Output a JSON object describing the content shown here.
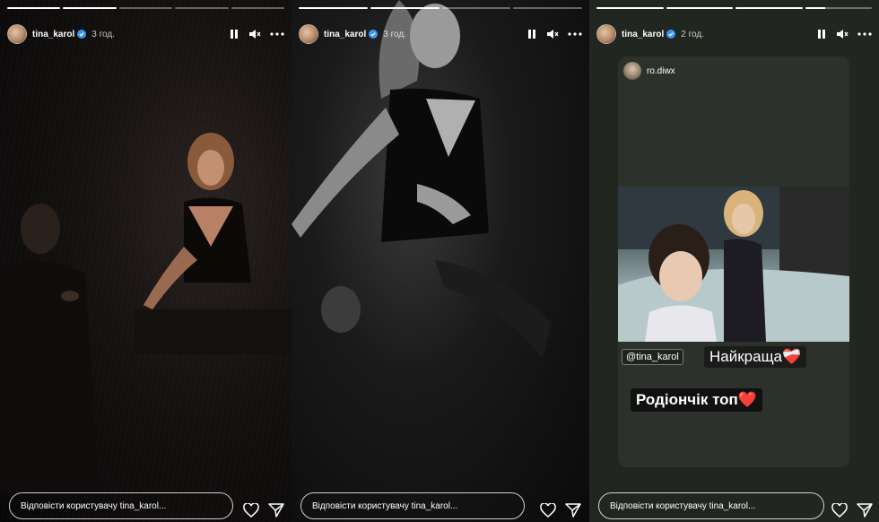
{
  "stories": [
    {
      "username": "tina_karol",
      "timestamp": "3 год.",
      "reply_placeholder": "Відповісти користувачу tina_karol...",
      "progress": [
        1,
        1,
        0,
        0,
        0
      ]
    },
    {
      "username": "tina_karol",
      "timestamp": "3 год.",
      "reply_placeholder": "Відповісти користувачу tina_karol...",
      "progress": [
        1,
        1,
        0,
        0
      ]
    },
    {
      "username": "tina_karol",
      "timestamp": "2 год.",
      "reply_placeholder": "Відповісти користувачу tina_karol...",
      "progress": [
        1,
        1,
        1,
        0.3
      ],
      "repost": {
        "username": "ro.diwx",
        "mention": "@tina_karol",
        "sticker_1": "Найкраща❤️‍🩹",
        "sticker_2": "Родіончік топ❤️"
      }
    }
  ],
  "colors": {
    "verified": "#3897f0",
    "text": "#ffffff",
    "card_bg": "#2d312b"
  },
  "icons": [
    "pause-icon",
    "mute-icon",
    "more-icon",
    "heart-icon",
    "send-icon",
    "verified-icon"
  ]
}
